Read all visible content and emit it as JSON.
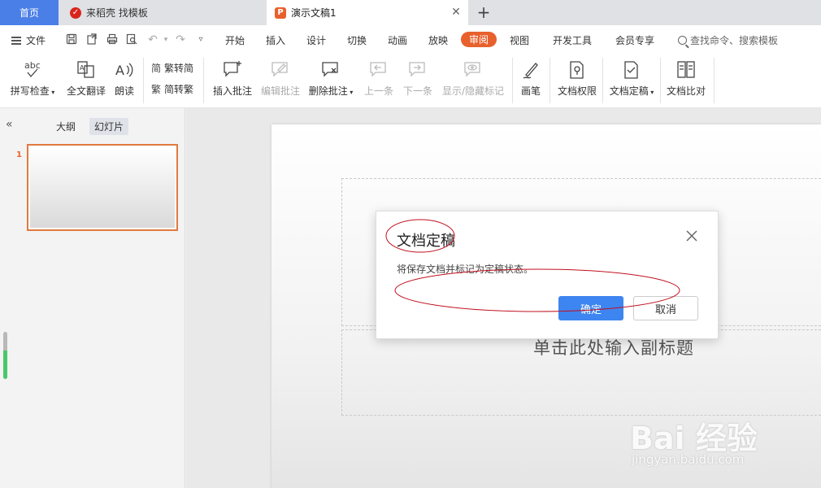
{
  "tabs": {
    "home": "首页",
    "daoke": "来稻壳 找模板",
    "doc": "演示文稿1",
    "add": "+"
  },
  "menu": {
    "file": "文件",
    "tabs": [
      "开始",
      "插入",
      "设计",
      "切换",
      "动画",
      "放映",
      "审阅",
      "视图",
      "开发工具",
      "会员专享"
    ],
    "active_tab": "审阅",
    "search": "查找命令、搜索模板"
  },
  "ribbon": {
    "spell": "拼写检查",
    "translate": "全文翻译",
    "read": "朗读",
    "trad": "繁转简",
    "simp": "简转繁",
    "insert_comment": "插入批注",
    "edit_comment": "编辑批注",
    "delete_comment": "删除批注",
    "prev": "上一条",
    "next": "下一条",
    "show_hide": "显示/隐藏标记",
    "pen": "画笔",
    "permission": "文档权限",
    "finalize": "文档定稿",
    "compare": "文档比对"
  },
  "left_panel": {
    "outline": "大纲",
    "slides": "幻灯片",
    "slide_number": "1"
  },
  "slide": {
    "subtitle_placeholder": "单击此处输入副标题"
  },
  "dialog": {
    "title": "文档定稿",
    "message": "将保存文档并标记为定稿状态。",
    "ok": "确定",
    "cancel": "取消"
  },
  "watermark": {
    "brand": "Bai 经验",
    "url": "jingyan.baidu.com"
  },
  "colors": {
    "accent": "#e8602c",
    "primary_button": "#3d85f0",
    "home_tab": "#4a7fe8",
    "annotation": "#c0101f"
  }
}
